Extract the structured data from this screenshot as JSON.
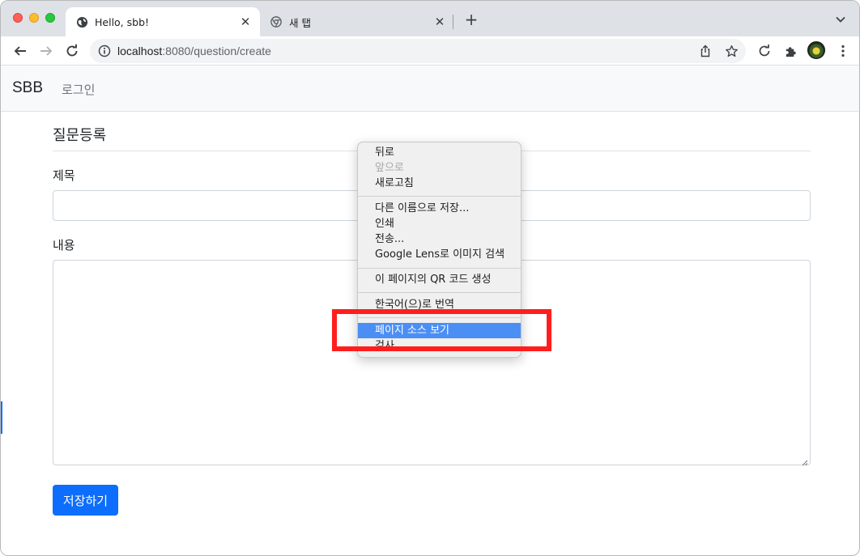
{
  "browser": {
    "tabs": [
      {
        "title": "Hello, sbb!",
        "icon": "globe-icon"
      },
      {
        "title": "새 탭",
        "icon": "chrome-icon"
      }
    ],
    "address": {
      "host": "localhost",
      "rest": ":8080/question/create"
    }
  },
  "navbar": {
    "brand": "SBB",
    "login": "로그인"
  },
  "form": {
    "heading": "질문등록",
    "subject_label": "제목",
    "subject_value": "",
    "content_label": "내용",
    "content_value": "",
    "save_label": "저장하기"
  },
  "context_menu": {
    "items": [
      {
        "label": "뒤로",
        "disabled": false
      },
      {
        "label": "앞으로",
        "disabled": true
      },
      {
        "label": "새로고침",
        "disabled": false
      },
      {
        "label": "다른 이름으로 저장...",
        "disabled": false
      },
      {
        "label": "인쇄",
        "disabled": false
      },
      {
        "label": "전송...",
        "disabled": false
      },
      {
        "label": "Google Lens로 이미지 검색",
        "disabled": false
      },
      {
        "label": "이 페이지의 QR 코드 생성",
        "disabled": false
      },
      {
        "label": "한국어(으)로 번역",
        "disabled": false
      },
      {
        "label": "페이지 소스 보기",
        "disabled": false,
        "highlighted": true
      },
      {
        "label": "검사",
        "disabled": false
      }
    ]
  },
  "colors": {
    "primary": "#0d6efd",
    "highlight": "#4b8ff5",
    "annotation": "#ff1e1e"
  }
}
